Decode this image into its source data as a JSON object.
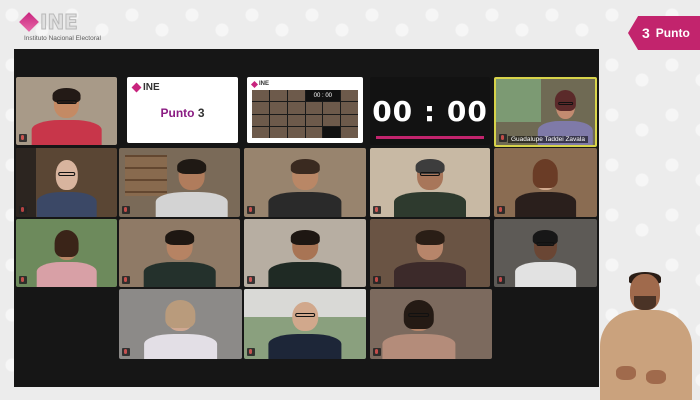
{
  "broadcast": {
    "logo_text": "INE",
    "logo_subtitle": "Instituto Nacional Electoral",
    "agenda_number": "3",
    "agenda_label": "Punto",
    "brand_color": "#c2246d"
  },
  "meeting": {
    "slide": {
      "logo_text": "INE",
      "title_word": "Punto",
      "title_number": "3"
    },
    "timer": {
      "display": "00 : 00"
    },
    "mini_gallery": {
      "logo_text": "INE",
      "timer": "00 : 00"
    },
    "featured_name": "Guadalupe Taddei Zavala"
  }
}
